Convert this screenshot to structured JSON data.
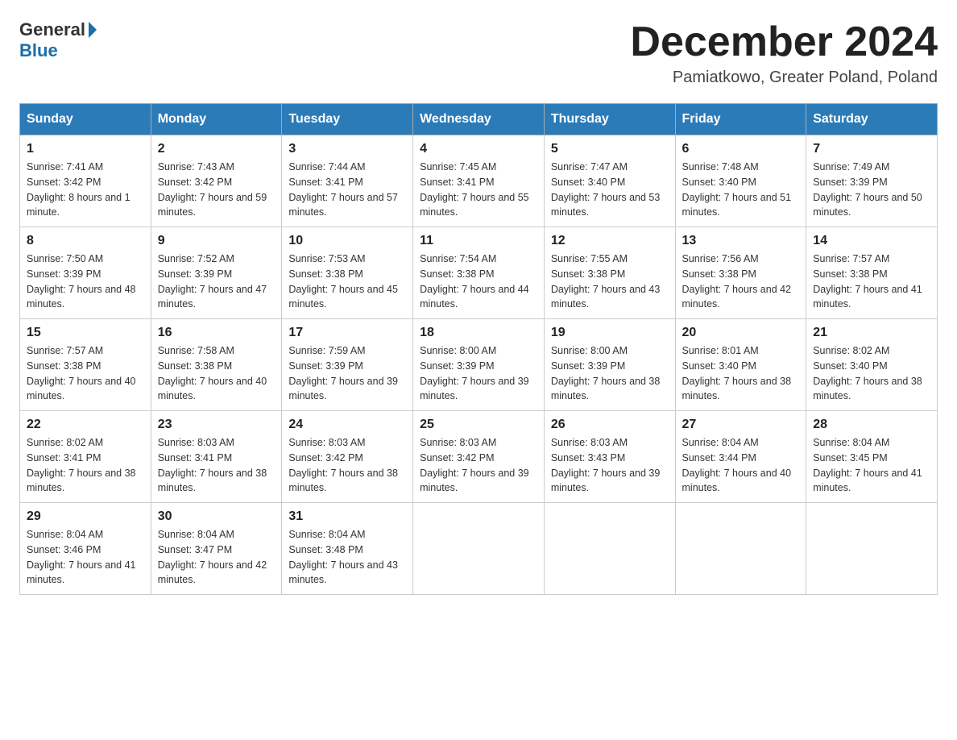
{
  "header": {
    "logo_general": "General",
    "logo_blue": "Blue",
    "month_title": "December 2024",
    "location": "Pamiatkowo, Greater Poland, Poland"
  },
  "days_of_week": [
    "Sunday",
    "Monday",
    "Tuesday",
    "Wednesday",
    "Thursday",
    "Friday",
    "Saturday"
  ],
  "weeks": [
    [
      {
        "day": "1",
        "sunrise": "7:41 AM",
        "sunset": "3:42 PM",
        "daylight": "8 hours and 1 minute."
      },
      {
        "day": "2",
        "sunrise": "7:43 AM",
        "sunset": "3:42 PM",
        "daylight": "7 hours and 59 minutes."
      },
      {
        "day": "3",
        "sunrise": "7:44 AM",
        "sunset": "3:41 PM",
        "daylight": "7 hours and 57 minutes."
      },
      {
        "day": "4",
        "sunrise": "7:45 AM",
        "sunset": "3:41 PM",
        "daylight": "7 hours and 55 minutes."
      },
      {
        "day": "5",
        "sunrise": "7:47 AM",
        "sunset": "3:40 PM",
        "daylight": "7 hours and 53 minutes."
      },
      {
        "day": "6",
        "sunrise": "7:48 AM",
        "sunset": "3:40 PM",
        "daylight": "7 hours and 51 minutes."
      },
      {
        "day": "7",
        "sunrise": "7:49 AM",
        "sunset": "3:39 PM",
        "daylight": "7 hours and 50 minutes."
      }
    ],
    [
      {
        "day": "8",
        "sunrise": "7:50 AM",
        "sunset": "3:39 PM",
        "daylight": "7 hours and 48 minutes."
      },
      {
        "day": "9",
        "sunrise": "7:52 AM",
        "sunset": "3:39 PM",
        "daylight": "7 hours and 47 minutes."
      },
      {
        "day": "10",
        "sunrise": "7:53 AM",
        "sunset": "3:38 PM",
        "daylight": "7 hours and 45 minutes."
      },
      {
        "day": "11",
        "sunrise": "7:54 AM",
        "sunset": "3:38 PM",
        "daylight": "7 hours and 44 minutes."
      },
      {
        "day": "12",
        "sunrise": "7:55 AM",
        "sunset": "3:38 PM",
        "daylight": "7 hours and 43 minutes."
      },
      {
        "day": "13",
        "sunrise": "7:56 AM",
        "sunset": "3:38 PM",
        "daylight": "7 hours and 42 minutes."
      },
      {
        "day": "14",
        "sunrise": "7:57 AM",
        "sunset": "3:38 PM",
        "daylight": "7 hours and 41 minutes."
      }
    ],
    [
      {
        "day": "15",
        "sunrise": "7:57 AM",
        "sunset": "3:38 PM",
        "daylight": "7 hours and 40 minutes."
      },
      {
        "day": "16",
        "sunrise": "7:58 AM",
        "sunset": "3:38 PM",
        "daylight": "7 hours and 40 minutes."
      },
      {
        "day": "17",
        "sunrise": "7:59 AM",
        "sunset": "3:39 PM",
        "daylight": "7 hours and 39 minutes."
      },
      {
        "day": "18",
        "sunrise": "8:00 AM",
        "sunset": "3:39 PM",
        "daylight": "7 hours and 39 minutes."
      },
      {
        "day": "19",
        "sunrise": "8:00 AM",
        "sunset": "3:39 PM",
        "daylight": "7 hours and 38 minutes."
      },
      {
        "day": "20",
        "sunrise": "8:01 AM",
        "sunset": "3:40 PM",
        "daylight": "7 hours and 38 minutes."
      },
      {
        "day": "21",
        "sunrise": "8:02 AM",
        "sunset": "3:40 PM",
        "daylight": "7 hours and 38 minutes."
      }
    ],
    [
      {
        "day": "22",
        "sunrise": "8:02 AM",
        "sunset": "3:41 PM",
        "daylight": "7 hours and 38 minutes."
      },
      {
        "day": "23",
        "sunrise": "8:03 AM",
        "sunset": "3:41 PM",
        "daylight": "7 hours and 38 minutes."
      },
      {
        "day": "24",
        "sunrise": "8:03 AM",
        "sunset": "3:42 PM",
        "daylight": "7 hours and 38 minutes."
      },
      {
        "day": "25",
        "sunrise": "8:03 AM",
        "sunset": "3:42 PM",
        "daylight": "7 hours and 39 minutes."
      },
      {
        "day": "26",
        "sunrise": "8:03 AM",
        "sunset": "3:43 PM",
        "daylight": "7 hours and 39 minutes."
      },
      {
        "day": "27",
        "sunrise": "8:04 AM",
        "sunset": "3:44 PM",
        "daylight": "7 hours and 40 minutes."
      },
      {
        "day": "28",
        "sunrise": "8:04 AM",
        "sunset": "3:45 PM",
        "daylight": "7 hours and 41 minutes."
      }
    ],
    [
      {
        "day": "29",
        "sunrise": "8:04 AM",
        "sunset": "3:46 PM",
        "daylight": "7 hours and 41 minutes."
      },
      {
        "day": "30",
        "sunrise": "8:04 AM",
        "sunset": "3:47 PM",
        "daylight": "7 hours and 42 minutes."
      },
      {
        "day": "31",
        "sunrise": "8:04 AM",
        "sunset": "3:48 PM",
        "daylight": "7 hours and 43 minutes."
      },
      null,
      null,
      null,
      null
    ]
  ]
}
